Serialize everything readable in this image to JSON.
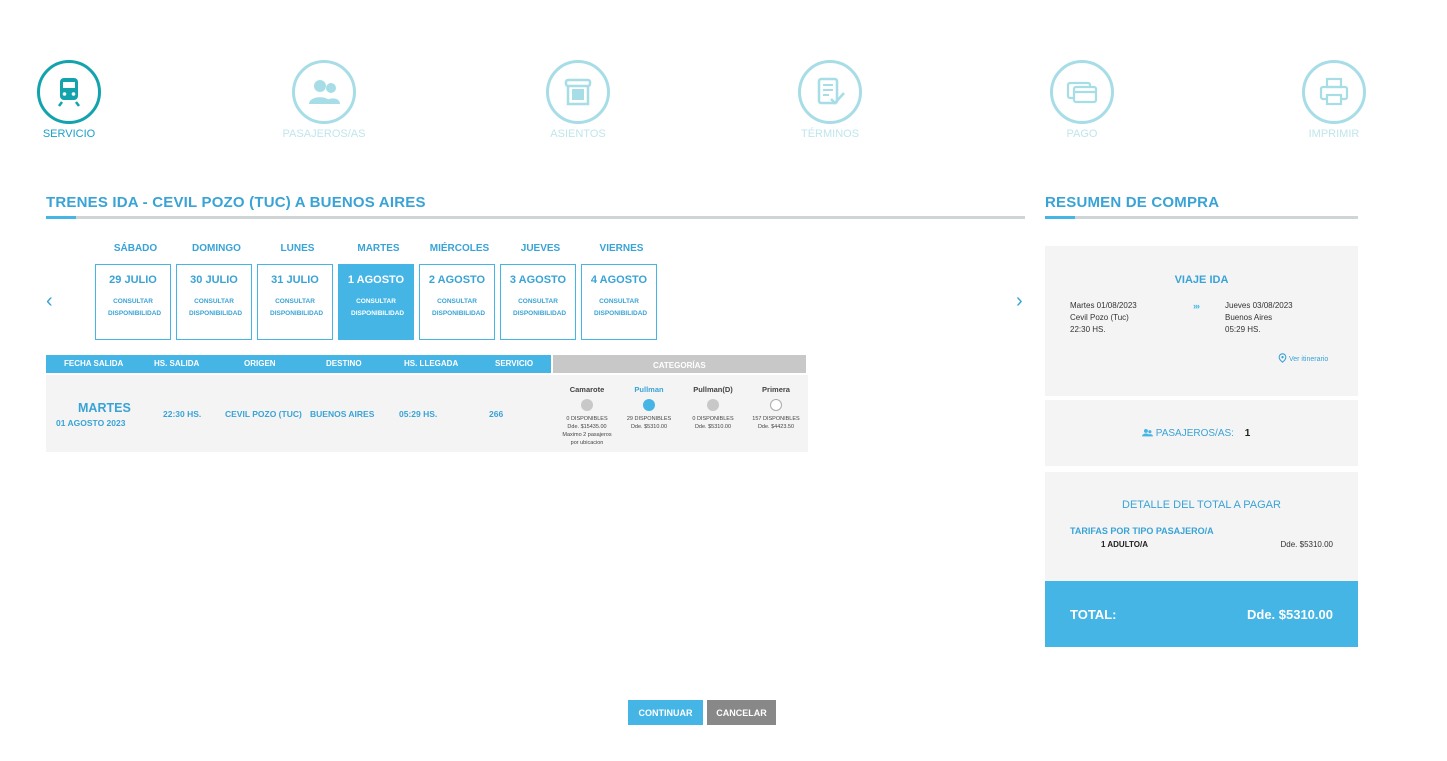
{
  "steps": [
    {
      "label": "SERVICIO",
      "icon": "train-icon",
      "active": true
    },
    {
      "label": "PASAJEROS/AS",
      "icon": "users-icon",
      "active": false
    },
    {
      "label": "ASIENTOS",
      "icon": "seat-icon",
      "active": false
    },
    {
      "label": "TÉRMINOS",
      "icon": "terms-icon",
      "active": false
    },
    {
      "label": "PAGO",
      "icon": "card-icon",
      "active": false
    },
    {
      "label": "IMPRIMIR",
      "icon": "printer-icon",
      "active": false
    }
  ],
  "trip": {
    "title": "TRENES IDA - CEVIL POZO (TUC)   A   BUENOS AIRES",
    "days": [
      {
        "name": "SÁBADO",
        "date": "29 JULIO",
        "status": "CONSULTAR DISPONIBILIDAD"
      },
      {
        "name": "DOMINGO",
        "date": "30 JULIO",
        "status": "CONSULTAR DISPONIBILIDAD"
      },
      {
        "name": "LUNES",
        "date": "31 JULIO",
        "status": "CONSULTAR DISPONIBILIDAD"
      },
      {
        "name": "MARTES",
        "date": "1 AGOSTO",
        "status": "CONSULTAR DISPONIBILIDAD"
      },
      {
        "name": "MIÉRCOLES",
        "date": "2 AGOSTO",
        "status": "CONSULTAR DISPONIBILIDAD"
      },
      {
        "name": "JUEVES",
        "date": "3 AGOSTO",
        "status": "CONSULTAR DISPONIBILIDAD"
      },
      {
        "name": "VIERNES",
        "date": "4 AGOSTO",
        "status": "CONSULTAR DISPONIBILIDAD"
      }
    ],
    "prev_arrow": "‹",
    "next_arrow": "›"
  },
  "table": {
    "headers": [
      "FECHA SALIDA",
      "HS. SALIDA",
      "ORIGEN",
      "DESTINO",
      "HS. LLEGADA",
      "SERVICIO"
    ],
    "categories_header": "CATEGORÍAS",
    "row": {
      "day": "MARTES",
      "date": "01 AGOSTO 2023",
      "departure": "22:30 HS.",
      "origin": "CEVIL POZO (TUC)",
      "destination": "BUENOS AIRES",
      "arrival": "05:29 HS.",
      "service": "266"
    },
    "categories": [
      {
        "name": "Camarote",
        "available": "0 DISPONIBLES",
        "price": "Dde. $15435.00",
        "note1": "Maximo 2 pasajeros",
        "note2": "por ubicacion"
      },
      {
        "name": "Pullman",
        "available": "29 DISPONIBLES",
        "price": "Dde. $5310.00"
      },
      {
        "name": "Pullman(D)",
        "available": "0 DISPONIBLES",
        "price": "Dde. $5310.00"
      },
      {
        "name": "Primera",
        "available": "157 DISPONIBLES",
        "price": "Dde. $4423.50"
      }
    ]
  },
  "summary": {
    "title": "RESUMEN DE COMPRA",
    "trip_title": "VIAJE IDA",
    "from_date": "Martes 01/08/2023",
    "from_place": "Cevil Pozo (Tuc)",
    "from_time": "22:30 HS.",
    "to_date": "Jueves 03/08/2023",
    "to_place": "Buenos Aires",
    "to_time": "05:29 HS.",
    "arrows": "›››",
    "itinerary_link": "Ver itinerario",
    "passengers_label": "PASAJEROS/AS:",
    "passengers_count": "1",
    "detail_title": "DETALLE DEL TOTAL A PAGAR",
    "fare_title": "TARIFAS POR TIPO PASAJERO/A",
    "fare_item": "1 ADULTO/A",
    "fare_price": "Dde. $5310.00",
    "total_label": "TOTAL:",
    "total_value": "Dde. $5310.00"
  },
  "buttons": {
    "continue": "CONTINUAR",
    "cancel": "CANCELAR"
  },
  "colors": {
    "accent": "#45b5e6",
    "step_active": "#12a3ad",
    "step_inactive": "#a7dde6",
    "cancel": "#888888"
  }
}
